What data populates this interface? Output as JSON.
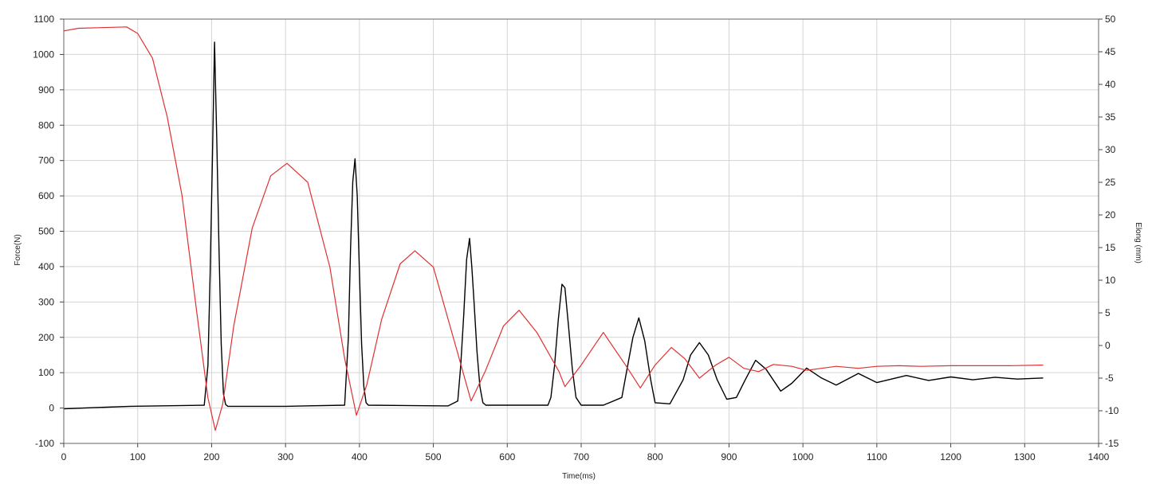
{
  "chart_data": {
    "type": "line",
    "title": "",
    "xlabel": "Time(ms)",
    "ylabel": "Force(N)",
    "y2label": "Elong (mm)",
    "xlim": [
      0,
      1400
    ],
    "ylim": [
      -100,
      1100
    ],
    "y2lim": [
      -15,
      50
    ],
    "grid": true,
    "x_ticks": [
      "0",
      "100",
      "200",
      "300",
      "400",
      "500",
      "600",
      "700",
      "800",
      "900",
      "1000",
      "1100",
      "1200",
      "1300",
      "1400"
    ],
    "y_ticks": [
      "-100",
      "0",
      "100",
      "200",
      "300",
      "400",
      "500",
      "600",
      "700",
      "800",
      "900",
      "1000",
      "1100"
    ],
    "y2_ticks": [
      "-15",
      "-10",
      "-5",
      "0",
      "5",
      "10",
      "15",
      "20",
      "25",
      "30",
      "35",
      "40",
      "45",
      "50"
    ],
    "series": [
      {
        "axis": "left",
        "color": "#000000",
        "x": [
          0,
          90,
          190,
          195,
          198,
          201,
          204,
          207,
          210,
          213,
          216,
          219,
          222,
          300,
          380,
          385,
          388,
          391,
          394,
          397,
          400,
          403,
          406,
          409,
          412,
          520,
          533,
          537,
          541,
          545,
          549,
          552,
          555,
          559,
          563,
          567,
          571,
          655,
          659,
          664,
          669,
          674,
          678,
          683,
          688,
          693,
          700,
          730,
          755,
          762,
          770,
          778,
          786,
          794,
          800,
          820,
          838,
          848,
          860,
          872,
          884,
          897,
          910,
          922,
          936,
          950,
          970,
          985,
          1005,
          1025,
          1045,
          1075,
          1100,
          1140,
          1170,
          1200,
          1230,
          1260,
          1290,
          1325
        ],
        "y": [
          -2,
          5,
          8,
          120,
          380,
          700,
          1035,
          760,
          450,
          180,
          40,
          10,
          5,
          5,
          8,
          200,
          450,
          640,
          705,
          600,
          380,
          180,
          60,
          15,
          8,
          6,
          20,
          120,
          260,
          420,
          480,
          400,
          300,
          160,
          60,
          15,
          8,
          8,
          30,
          120,
          250,
          350,
          340,
          230,
          110,
          30,
          8,
          8,
          30,
          110,
          200,
          255,
          190,
          80,
          15,
          12,
          80,
          150,
          185,
          150,
          80,
          25,
          30,
          80,
          135,
          110,
          48,
          70,
          113,
          85,
          65,
          98,
          72,
          92,
          78,
          88,
          80,
          87,
          82,
          85
        ]
      },
      {
        "axis": "right",
        "color": "#e03030",
        "x": [
          0,
          20,
          85,
          100,
          120,
          140,
          160,
          180,
          195,
          205,
          215,
          230,
          255,
          280,
          302,
          330,
          360,
          380,
          396,
          410,
          430,
          455,
          475,
          500,
          530,
          551,
          570,
          595,
          616,
          640,
          670,
          678,
          700,
          730,
          760,
          780,
          800,
          822,
          840,
          860,
          882,
          900,
          920,
          940,
          960,
          985,
          1005,
          1025,
          1045,
          1075,
          1100,
          1130,
          1160,
          1200,
          1240,
          1280,
          1325
        ],
        "y": [
          48.2,
          48.6,
          48.8,
          47.8,
          44.0,
          35.0,
          23.0,
          5.0,
          -8.0,
          -13.0,
          -9.0,
          3.0,
          18.0,
          26.0,
          27.9,
          25.0,
          12.0,
          -2.0,
          -10.7,
          -6.0,
          4.0,
          12.5,
          14.5,
          12.0,
          0.0,
          -8.5,
          -4.0,
          3.0,
          5.4,
          2.0,
          -4.0,
          -6.3,
          -3.0,
          2.0,
          -3.0,
          -6.5,
          -3.0,
          -0.3,
          -2.0,
          -5.0,
          -3.0,
          -1.8,
          -3.5,
          -4.0,
          -2.9,
          -3.2,
          -3.8,
          -3.5,
          -3.2,
          -3.5,
          -3.2,
          -3.1,
          -3.2,
          -3.1,
          -3.1,
          -3.1,
          -3.0
        ]
      }
    ]
  }
}
